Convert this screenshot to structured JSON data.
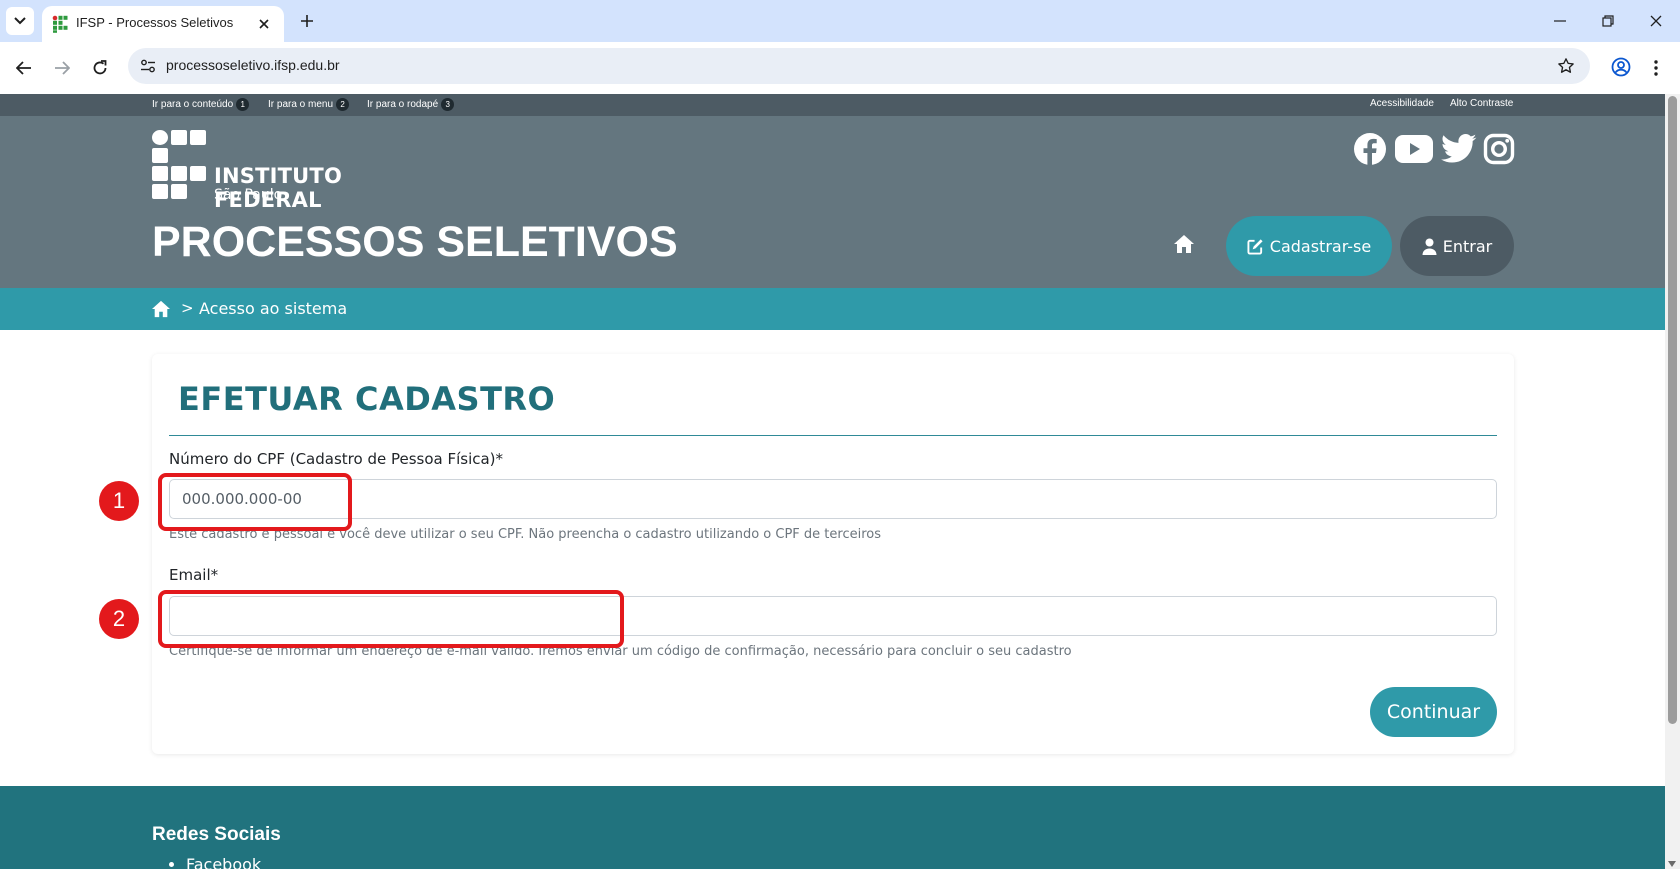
{
  "browser": {
    "tab_title": "IFSP - Processos Seletivos",
    "url": "processoseletivo.ifsp.edu.br"
  },
  "accessibility_bar": {
    "skip_links": [
      {
        "label": "Ir para o conteúdo",
        "num": "1"
      },
      {
        "label": "Ir para o menu",
        "num": "2"
      },
      {
        "label": "Ir para o rodapé",
        "num": "3"
      }
    ],
    "acessibilidade": "Acessibilidade",
    "alto_contraste": "Alto Contraste"
  },
  "header": {
    "logo_name": "INSTITUTO FEDERAL",
    "logo_sub": "São Paulo",
    "title": "PROCESSOS SELETIVOS",
    "social_icons": [
      "facebook-icon",
      "youtube-icon",
      "twitter-icon",
      "instagram-icon"
    ],
    "cadastrar_label": "Cadastrar-se",
    "entrar_label": "Entrar"
  },
  "breadcrumb": {
    "separator": ">",
    "current": "Acesso ao sistema"
  },
  "form": {
    "title": "EFETUAR CADASTRO",
    "cpf_label": "Número do CPF (Cadastro de Pessoa Física)*",
    "cpf_placeholder": "000.000.000-00",
    "cpf_help": "Este cadastro é pessoal e você deve utilizar o seu CPF. Não preencha o cadastro utilizando o CPF de terceiros",
    "email_label": "Email*",
    "email_value": "",
    "email_help": "Certifique-se de informar um endereço de e-mail válido. Iremos enviar um código de confirmação, necessário para concluir o seu cadastro",
    "continue_label": "Continuar"
  },
  "annotations": [
    "1",
    "2"
  ],
  "footer": {
    "title": "Redes Sociais",
    "items": [
      "Facebook"
    ]
  },
  "colors": {
    "header_bg": "#64767f",
    "accent_teal": "#2f9aa9",
    "title_teal": "#216f7b",
    "footer_bg": "#21737e",
    "annotation_red": "#e3191c"
  }
}
